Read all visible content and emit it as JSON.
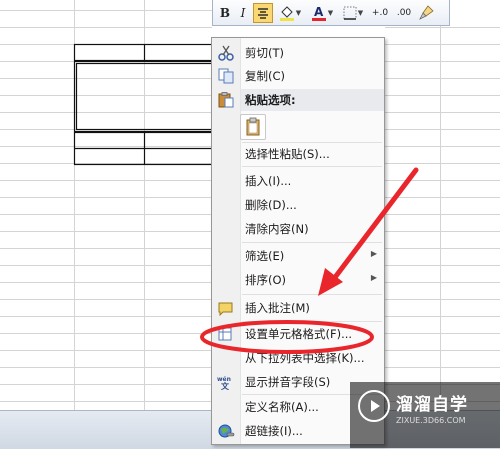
{
  "toolbar": {
    "bold_label": "B",
    "italic_label": "I",
    "decimal_increase_label": "+.0",
    "decimal_decrease_label": ".00",
    "highlight_color": "#f9d772",
    "font_color": "#e3262b",
    "fill_color": "#f0e442"
  },
  "menu": {
    "items": [
      {
        "label": "剪切(T)",
        "icon": "scissors-icon"
      },
      {
        "label": "复制(C)",
        "icon": "copy-icon"
      },
      {
        "label": "粘贴选项:",
        "icon": "paste-icon"
      },
      {
        "label": "选择性粘贴(S)..."
      },
      {
        "label": "插入(I)..."
      },
      {
        "label": "删除(D)..."
      },
      {
        "label": "清除内容(N)"
      },
      {
        "label": "筛选(E)",
        "has_submenu": true
      },
      {
        "label": "排序(O)",
        "has_submenu": true
      },
      {
        "label": "插入批注(M)",
        "icon": "comment-icon"
      },
      {
        "label": "设置单元格格式(F)...",
        "icon": "format-cells-icon"
      },
      {
        "label": "从下拉列表中选择(K)..."
      },
      {
        "label": "显示拼音字段(S)",
        "icon": "pinyin-icon"
      },
      {
        "label": "定义名称(A)..."
      },
      {
        "label": "超链接(I)...",
        "icon": "hyperlink-icon"
      }
    ]
  },
  "annotation_color": "#e8262b",
  "watermark": {
    "title": "溜溜自学",
    "subtitle": "ZIXUE.3D66.COM"
  }
}
